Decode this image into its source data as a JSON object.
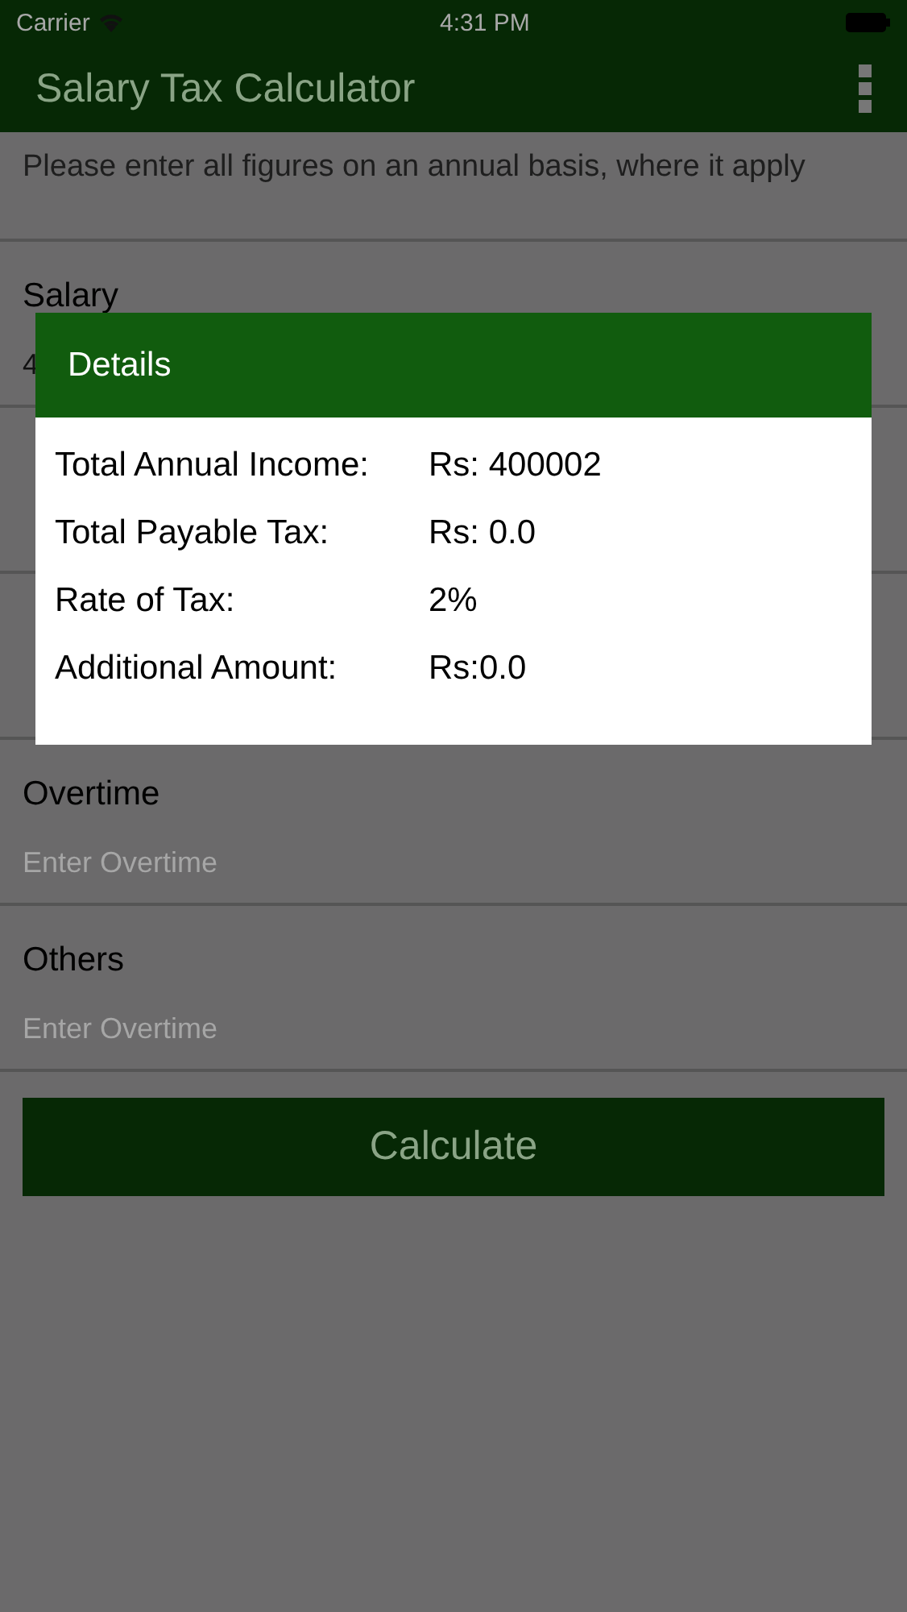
{
  "status_bar": {
    "carrier": "Carrier",
    "time": "4:31 PM"
  },
  "app_bar": {
    "title": "Salary Tax Calculator"
  },
  "instruction": "Please enter all figures on  an annual basis, where it apply",
  "fields": [
    {
      "kind": "input",
      "label": "Salary",
      "value": "4"
    },
    {
      "kind": "covered"
    },
    {
      "kind": "covered"
    },
    {
      "kind": "input",
      "label": "Overtime",
      "placeholder": "Enter Overtime"
    },
    {
      "kind": "input",
      "label": "Others",
      "placeholder": "Enter Overtime"
    }
  ],
  "button": "Calculate",
  "dialog": {
    "title": "Details",
    "rows": [
      {
        "label": "Total Annual Income:",
        "value": "Rs: 400002"
      },
      {
        "label": "Total Payable Tax:",
        "value": "Rs: 0.0"
      },
      {
        "label": "Rate of Tax:",
        "value": "2%"
      },
      {
        "label": "Additional Amount:",
        "value": "Rs:0.0"
      }
    ]
  }
}
